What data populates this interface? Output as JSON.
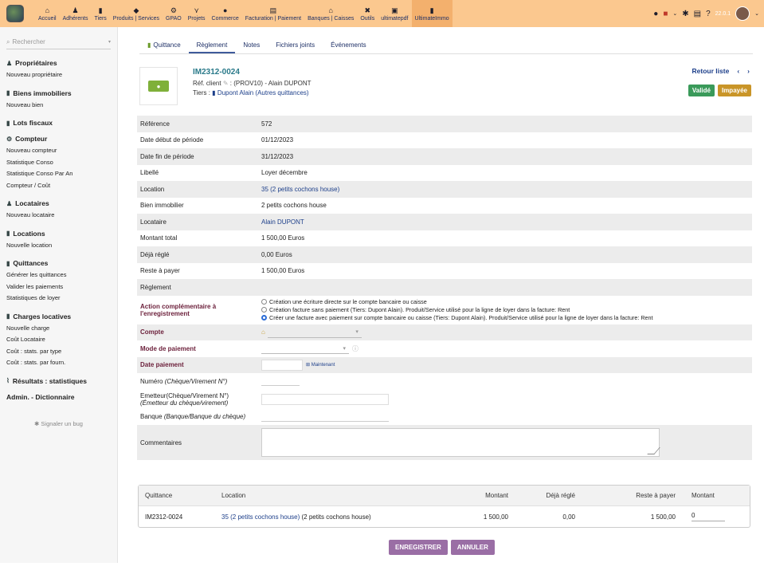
{
  "topnav": [
    {
      "label": "Accueil",
      "icon": "home-icon",
      "glyph": "⌂"
    },
    {
      "label": "Adhérents",
      "icon": "person-icon",
      "glyph": "♟"
    },
    {
      "label": "Tiers",
      "icon": "building-icon",
      "glyph": "▮"
    },
    {
      "label": "Produits | Services",
      "icon": "cube-icon",
      "glyph": "◆"
    },
    {
      "label": "GPAO",
      "icon": "industry-icon",
      "glyph": "⚙"
    },
    {
      "label": "Projets",
      "icon": "sitemap-icon",
      "glyph": "⋎"
    },
    {
      "label": "Commerce",
      "icon": "suitcase-icon",
      "glyph": "●"
    },
    {
      "label": "Facturation | Paiement",
      "icon": "invoice-icon",
      "glyph": "▤"
    },
    {
      "label": "Banques | Caisses",
      "icon": "bank-icon",
      "glyph": "⌂"
    },
    {
      "label": "Outils",
      "icon": "tools-icon",
      "glyph": "✖"
    },
    {
      "label": "ultimatepdf",
      "icon": "pdf-icon",
      "glyph": "▣"
    },
    {
      "label": "UltimateImmo",
      "icon": "building-icon",
      "glyph": "▮"
    }
  ],
  "version": "22.0.1",
  "search": {
    "placeholder": "Rechercher"
  },
  "sidebar": [
    {
      "title": "Propriétaires",
      "icon": "person-icon",
      "glyph": "♟",
      "links": [
        "Nouveau propriétaire"
      ]
    },
    {
      "title": "Biens immobiliers",
      "icon": "building-icon",
      "glyph": "▮",
      "links": [
        "Nouveau bien"
      ]
    },
    {
      "title": "Lots fiscaux",
      "icon": "building-icon",
      "glyph": "▮",
      "links": []
    },
    {
      "title": "Compteur",
      "icon": "car-icon",
      "glyph": "⚙",
      "links": [
        "Nouveau compteur",
        "Statistique Conso",
        "Statistique Conso Par An",
        "Compteur / Coût"
      ]
    },
    {
      "title": "Locataires",
      "icon": "person-icon",
      "glyph": "♟",
      "links": [
        "Nouveau locataire"
      ]
    },
    {
      "title": "Locations",
      "icon": "building-icon",
      "glyph": "▮",
      "links": [
        "Nouvelle location"
      ]
    },
    {
      "title": "Quittances",
      "icon": "document-icon",
      "glyph": "▮",
      "links": [
        "Générer les quittances",
        "Valider les paiements",
        "Statistiques de loyer"
      ]
    },
    {
      "title": "Charges locatives",
      "icon": "document-icon",
      "glyph": "▮",
      "links": [
        "Nouvelle charge",
        "Coût Locataire",
        "Coût : stats. par type",
        "Coût : stats. par fourn."
      ]
    },
    {
      "title": "Résultats : statistiques",
      "icon": "chart-icon",
      "glyph": "⌇",
      "links": []
    },
    {
      "title": "Admin. - Dictionnaire",
      "icon": "",
      "glyph": "",
      "links": []
    }
  ],
  "bug_link": "Signaler un bug",
  "tabs": [
    "Quittance",
    "Règlement",
    "Notes",
    "Fichiers joints",
    "Événements"
  ],
  "header": {
    "ref": "IM2312-0024",
    "ref_client_label": "Réf. client",
    "ref_client_value": ": (PROV10) - Alain DUPONT",
    "tiers_label": "Tiers :",
    "tiers_link": "Dupont Alain",
    "tiers_extra": "(Autres quittances)",
    "back": "Retour liste",
    "badge_valid": "Validé",
    "badge_unpaid": "Impayée"
  },
  "fields": [
    {
      "k": "Référence",
      "v": "572",
      "grey": true,
      "link": false
    },
    {
      "k": "Date début de période",
      "v": "01/12/2023",
      "grey": false,
      "link": false
    },
    {
      "k": "Date fin de période",
      "v": "31/12/2023",
      "grey": true,
      "link": false
    },
    {
      "k": "Libellé",
      "v": "Loyer décembre",
      "grey": false,
      "link": false
    },
    {
      "k": "Location",
      "v": "35 (2 petits cochons house)",
      "grey": true,
      "link": true
    },
    {
      "k": "Bien immobilier",
      "v": "2 petits cochons house",
      "grey": false,
      "link": false
    },
    {
      "k": "Locataire",
      "v": "Alain DUPONT",
      "grey": true,
      "link": true
    },
    {
      "k": "Montant total",
      "v": "1 500,00 Euros",
      "grey": false,
      "link": false
    },
    {
      "k": "Déjà réglé",
      "v": "0,00 Euros",
      "grey": true,
      "link": false
    },
    {
      "k": "Reste à payer",
      "v": "1 500,00 Euros",
      "grey": false,
      "link": false
    },
    {
      "k": "Règlement",
      "v": "",
      "grey": true,
      "link": false
    }
  ],
  "action": {
    "label": "Action complémentaire à l'enregistrement",
    "options": [
      {
        "text": "Création une écriture directe sur le compte bancaire ou caisse",
        "checked": false
      },
      {
        "text": "Création facture sans paiement (Tiers: Dupont Alain). Produit/Service utilisé pour la ligne de loyer dans la facture: Rent",
        "checked": false
      },
      {
        "text": "Créer une facture avec paiement sur compte bancaire ou caisse (Tiers: Dupont Alain). Produit/Service utilisé pour la ligne de loyer dans la facture: Rent",
        "checked": true
      }
    ]
  },
  "payment": {
    "compte": "Compte",
    "mode": "Mode de paiement",
    "date": "Date paiement",
    "now": "Maintenant",
    "numero": "Numéro",
    "numero_hint": "(Chèque/Virement N°)",
    "emetteur": "Emetteur(Chèque/Virement N°)",
    "emetteur_hint": "(Émetteur du chèque/virement)",
    "banque": "Banque",
    "banque_hint": "(Banque/Banque du chèque)",
    "commentaires": "Commentaires"
  },
  "table": {
    "headers": [
      "Quittance",
      "Location",
      "Montant",
      "Déjà réglé",
      "Reste à payer",
      "Montant"
    ],
    "row": {
      "quittance": "IM2312-0024",
      "location": "35 (2 petits cochons house)",
      "location_extra": "(2 petits cochons house)",
      "montant": "1 500,00",
      "deja": "0,00",
      "reste": "1 500,00",
      "input": "0"
    }
  },
  "buttons": {
    "save": "ENREGISTRER",
    "cancel": "ANNULER"
  }
}
